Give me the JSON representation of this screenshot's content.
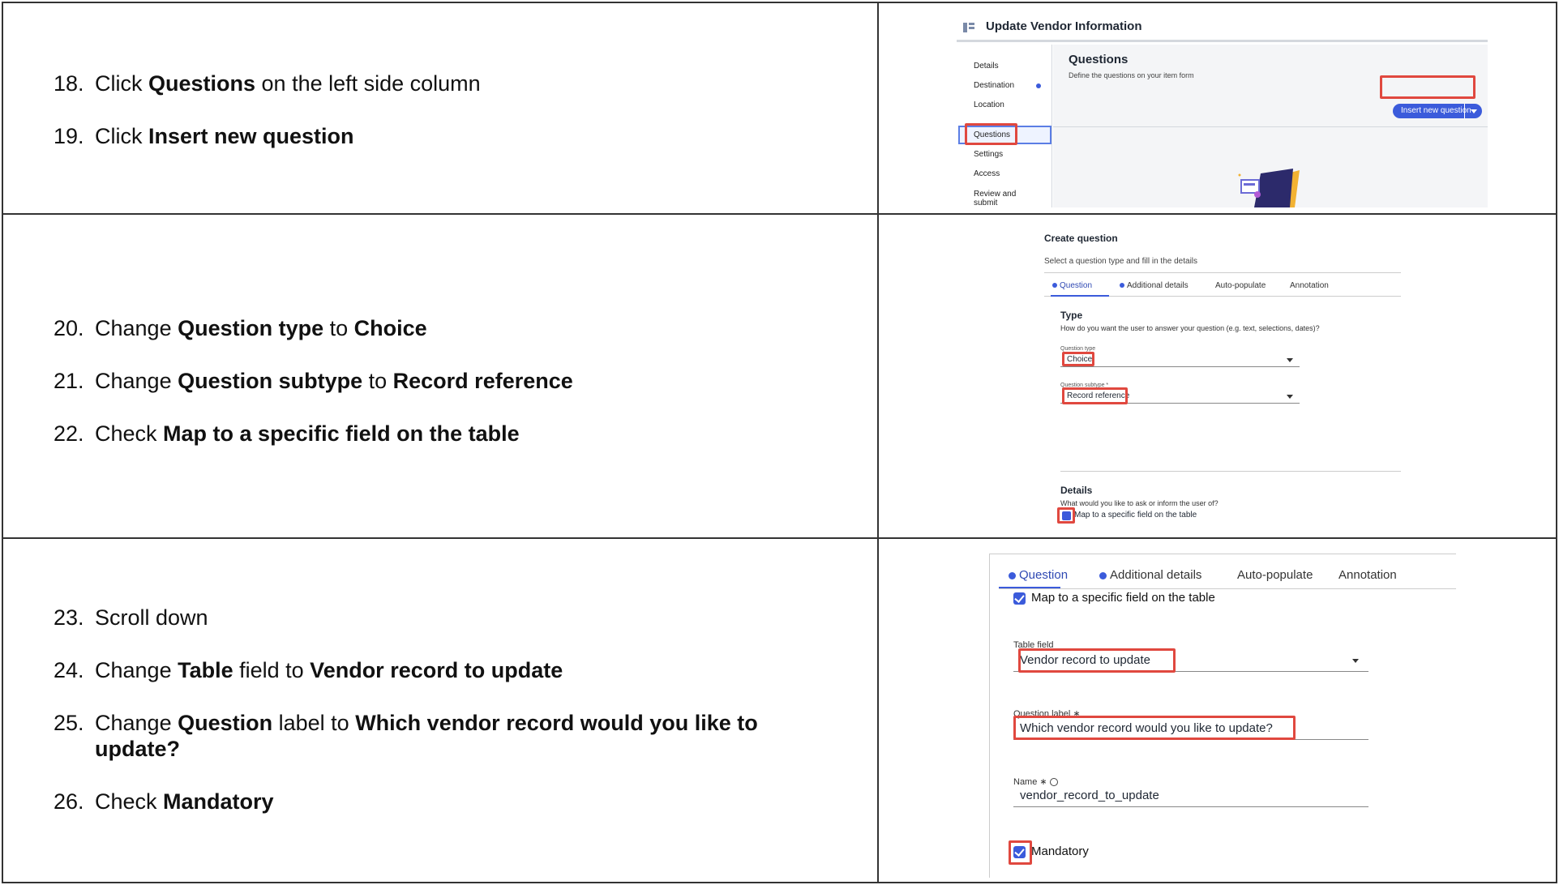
{
  "row1": {
    "steps": [
      {
        "num": "18.",
        "pre": "Click ",
        "b1": "Questions",
        "mid": " on the left side column"
      },
      {
        "num": "19.",
        "pre": "Click ",
        "b1": "Insert new question"
      }
    ],
    "screenshot": {
      "title": "Update Vendor Information",
      "sidebar": [
        "Details",
        "Destination",
        "Location",
        "Questions",
        "Settings",
        "Access",
        "Review and submit"
      ],
      "heading": "Questions",
      "description": "Define the questions on your item form",
      "button_label": "Insert new question"
    }
  },
  "row2": {
    "steps": [
      {
        "num": "20.",
        "pre": "Change ",
        "b1": "Question type",
        "mid": " to ",
        "b2": "Choice"
      },
      {
        "num": "21.",
        "pre": "Change ",
        "b1": "Question subtype",
        "mid": " to ",
        "b2": "Record reference"
      },
      {
        "num": "22.",
        "pre": "Check ",
        "b1": "Map to a specific field on the table"
      }
    ],
    "screenshot": {
      "title": "Create question",
      "subtitle": "Select a question type and fill in the details",
      "tabs": [
        "Question",
        "Additional details",
        "Auto-populate",
        "Annotation"
      ],
      "type_heading": "Type",
      "type_desc": "How do you want the user to answer your question (e.g. text, selections, dates)?",
      "qtype_label": "Question type",
      "qtype_value": "Choice",
      "qsubtype_label": "Question subtype *",
      "qsubtype_value": "Record reference",
      "details_heading": "Details",
      "details_desc": "What would you like to ask or inform the user of?",
      "map_label": "Map to a specific field on the table"
    }
  },
  "row3": {
    "steps": [
      {
        "num": "23.",
        "pre": "Scroll down"
      },
      {
        "num": "24.",
        "pre": "Change ",
        "b1": "Table",
        "mid": " field to ",
        "b2": "Vendor record to update"
      },
      {
        "num": "25.",
        "pre": "Change ",
        "b1": "Question",
        "mid": " label to ",
        "b2": "Which vendor record would you like to update?"
      },
      {
        "num": "26.",
        "pre": "Check ",
        "b1": "Mandatory"
      }
    ],
    "screenshot": {
      "tabs": [
        "Question",
        "Additional details",
        "Auto-populate",
        "Annotation"
      ],
      "map_label": "Map to a specific field on the table",
      "table_field_label": "Table field",
      "table_field_value": "Vendor record to update",
      "question_label_label": "Question label ∗",
      "question_label_value": "Which vendor record would you like to update?",
      "name_label": "Name ∗",
      "name_value": "vendor_record_to_update",
      "mandatory_label": "Mandatory"
    }
  },
  "colors": {
    "accent": "#3b5bdb",
    "highlight": "#e0483f",
    "border": "#333333"
  }
}
